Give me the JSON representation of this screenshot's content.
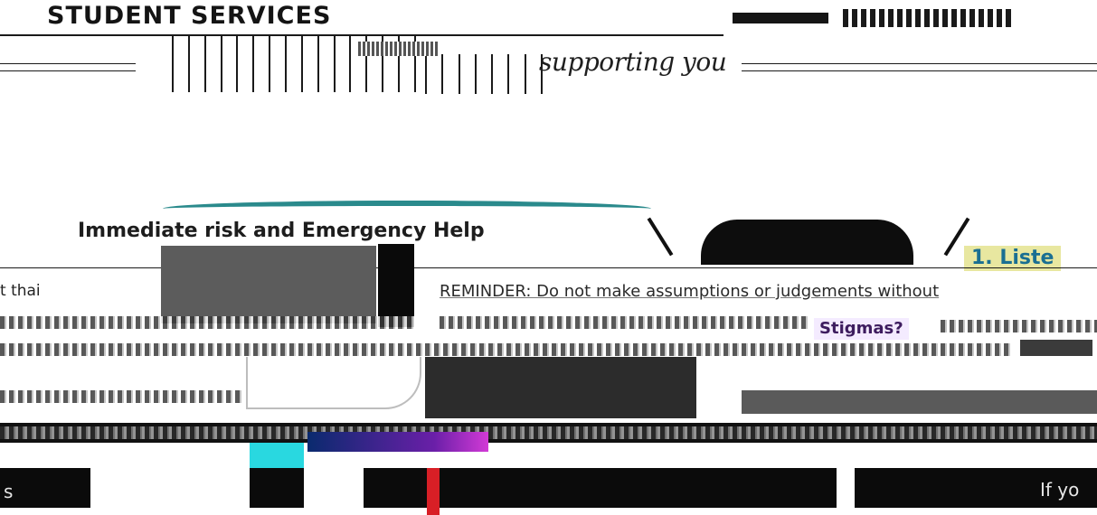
{
  "header": {
    "title": "STUDENT SERVICES",
    "tagline": "supporting you"
  },
  "section": {
    "title": "Immediate risk and Emergency Help",
    "step_label": "1. Liste",
    "left_fragment": "t thai",
    "reminder": "REMINDER: Do not make assumptions or judgements without",
    "badge": "Stigmas?",
    "bottom_left_fragment": "s",
    "bottom_right_fragment": "If yo"
  },
  "colors": {
    "teal_accent": "#2a8a8c",
    "step_highlight": "#e8e7a0",
    "step_text": "#1a6f92",
    "red_accent": "#d81f26",
    "cyan_accent": "#29d8e0"
  }
}
